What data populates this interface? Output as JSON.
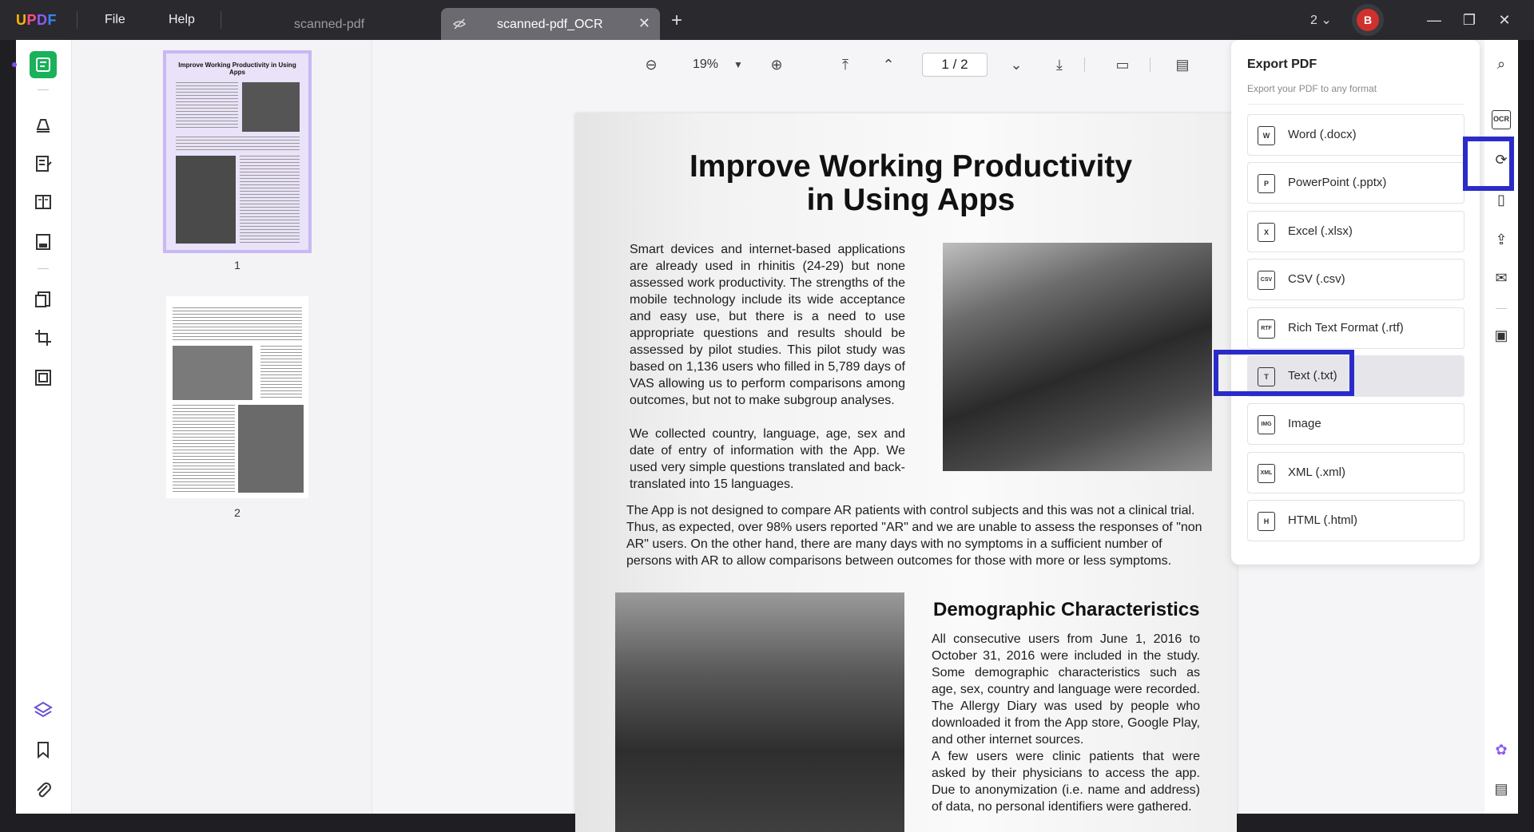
{
  "app": {
    "logo": "UPDF",
    "menu": [
      "File",
      "Help"
    ],
    "tabs": [
      {
        "label": "scanned-pdf"
      },
      {
        "label": "scanned-pdf_OCR"
      }
    ],
    "window_count": "2",
    "avatar_initial": "B"
  },
  "toolbar": {
    "zoom": "19%",
    "page_current": "1",
    "page_sep": "/",
    "page_total": "2"
  },
  "thumbnails": [
    {
      "num": "1",
      "title": "Improve Working Productivity in Using Apps"
    },
    {
      "num": "2"
    }
  ],
  "document": {
    "title_line1": "Improve Working Productivity",
    "title_line2": "in Using Apps",
    "para1": "Smart devices and internet-based applications are already used in rhinitis (24-29) but none assessed work productivity. The strengths of the mobile technology include its wide acceptance and easy use, but there is a need to use appropriate questions and results should be assessed by pilot studies. This pilot study was based on 1,136 users who filled in 5,789 days of VAS allowing us to perform comparisons among outcomes, but not to make subgroup analyses.",
    "para2": "We collected country, language, age, sex and date of entry of information with the App. We used very simple questions translated and back-translated into 15 languages.",
    "para3": "The App is not designed to compare AR patients with control subjects and this was not a clinical trial. Thus, as expected, over 98% users reported \"AR\" and we are unable to assess the responses of \"non AR\" users. On the other hand, there are many days with no symptoms in a sufficient number of persons with AR to allow comparisons between outcomes for those with more or less symptoms.",
    "heading2": "Demographic Characteristics",
    "para4": "All consecutive users from June 1, 2016 to October 31, 2016 were included in the study. Some demographic characteristics such as age, sex, country and language were recorded. The Allergy Diary was used by people who downloaded it from the App store, Google Play, and other internet sources.",
    "para5": "A few users were clinic patients that were asked by their physicians to access the app. Due to anonymization (i.e. name and address) of data, no personal identifiers were gathered."
  },
  "export_panel": {
    "title": "Export PDF",
    "subtitle": "Export your PDF to any format",
    "items": [
      {
        "label": "Word (.docx)",
        "icon": "W"
      },
      {
        "label": "PowerPoint (.pptx)",
        "icon": "P"
      },
      {
        "label": "Excel (.xlsx)",
        "icon": "X"
      },
      {
        "label": "CSV (.csv)",
        "icon": "CSV"
      },
      {
        "label": "Rich Text Format (.rtf)",
        "icon": "RTF"
      },
      {
        "label": "Text (.txt)",
        "icon": "T"
      },
      {
        "label": "Image",
        "icon": "IMG"
      },
      {
        "label": "XML (.xml)",
        "icon": "XML"
      },
      {
        "label": "HTML (.html)",
        "icon": "H"
      }
    ]
  },
  "colors": {
    "accent_green": "#19b15a",
    "highlight_blue": "#2b2bc9",
    "avatar_red": "#d0312d"
  }
}
